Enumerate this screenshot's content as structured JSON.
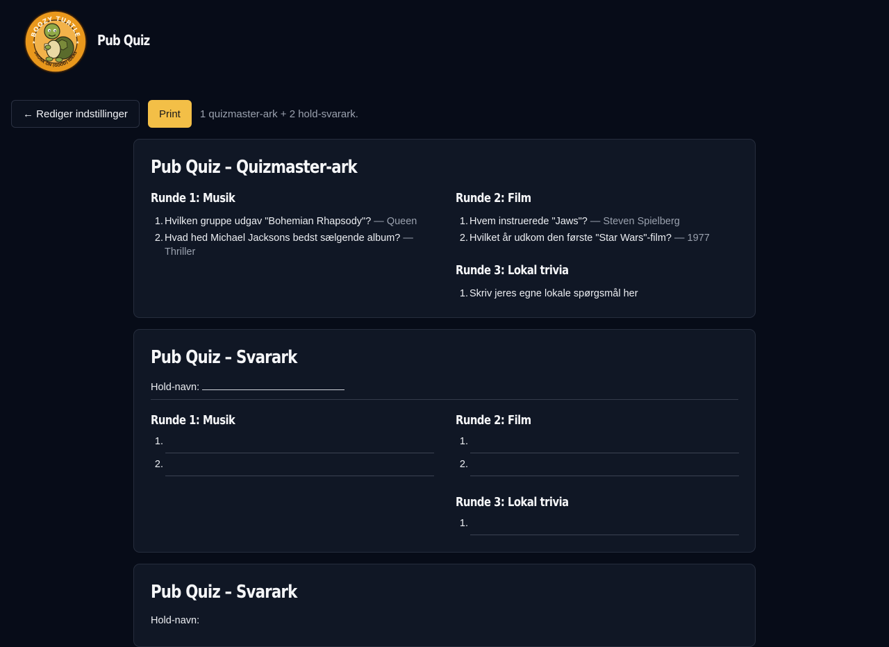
{
  "app": {
    "title": "Pub Quiz",
    "logo_alt": "Boozy Turtle logo"
  },
  "toolbar": {
    "back_label": "← Rediger indstillinger",
    "print_label": "Print",
    "status": "1 quizmaster-ark + 2 hold-svarark."
  },
  "colors": {
    "accent": "#f3bf47",
    "background": "#070c18",
    "card": "#101725",
    "muted": "#9aa1ae"
  },
  "quizmaster": {
    "title": "Pub Quiz – Quizmaster-ark",
    "rounds": [
      {
        "title": "Runde 1: Musik",
        "questions": [
          {
            "num": "1.",
            "text": "Hvilken gruppe udgav \"Bohemian Rhapsody\"?",
            "sep": " — ",
            "answer": "Queen"
          },
          {
            "num": "2.",
            "text": "Hvad hed Michael Jacksons bedst sælgende album?",
            "sep": " —",
            "answer": "Thriller"
          }
        ]
      },
      {
        "title": "Runde 2: Film",
        "questions": [
          {
            "num": "1.",
            "text": "Hvem instruerede \"Jaws\"?",
            "sep": " — ",
            "answer": "Steven Spielberg"
          },
          {
            "num": "2.",
            "text": "Hvilket år udkom den første \"Star Wars\"-film?",
            "sep": " — ",
            "answer": "1977"
          }
        ]
      },
      {
        "title": "Runde 3: Lokal trivia",
        "questions": [
          {
            "num": "1.",
            "text": "Skriv jeres egne lokale spørgsmål her",
            "sep": "",
            "answer": ""
          }
        ]
      }
    ]
  },
  "answer_sheets": [
    {
      "title": "Pub Quiz – Svarark",
      "team_label": "Hold-navn:",
      "rounds": [
        {
          "title": "Runde 1: Musik",
          "nums": [
            "1.",
            "2."
          ]
        },
        {
          "title": "Runde 2: Film",
          "nums": [
            "1.",
            "2."
          ]
        },
        {
          "title": "Runde 3: Lokal trivia",
          "nums": [
            "1."
          ]
        }
      ]
    },
    {
      "title": "Pub Quiz – Svarark",
      "team_label": "Hold-navn:"
    }
  ]
}
